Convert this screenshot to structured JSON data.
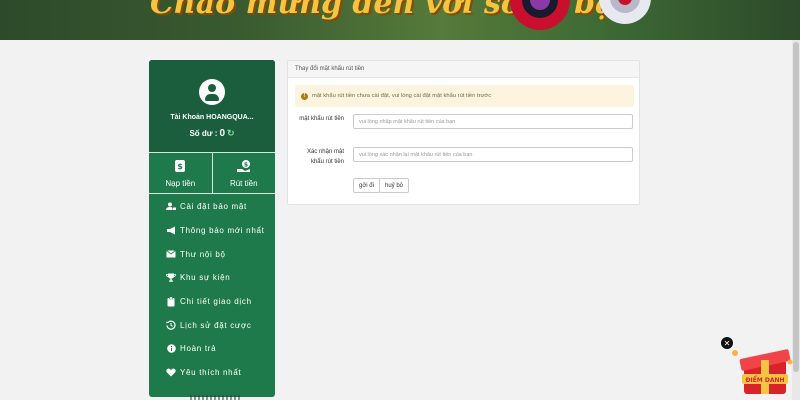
{
  "banner": {
    "text": "Chào mừng đến với sòng bạc"
  },
  "sidebar": {
    "account_name": "Tài Khoản HOANGQUA...",
    "balance_label": "Số dư :",
    "balance_value": "0",
    "deposit_label": "Nạp tiền",
    "withdraw_label": "Rút tiền",
    "menu": [
      {
        "label": "Cài đặt bảo mật",
        "icon": "user-lock-icon"
      },
      {
        "label": "Thông báo mới nhất",
        "icon": "megaphone-icon"
      },
      {
        "label": "Thư nội bộ",
        "icon": "envelope-icon"
      },
      {
        "label": "Khu sự kiện",
        "icon": "trophy-icon"
      },
      {
        "label": "Chi tiết giao dịch",
        "icon": "clipboard-icon"
      },
      {
        "label": "Lịch sử đặt cược",
        "icon": "history-icon"
      },
      {
        "label": "Hoàn trả",
        "icon": "info-circle-icon"
      },
      {
        "label": "Yêu thích nhất",
        "icon": "heart-icon"
      }
    ]
  },
  "panel": {
    "title": "Thay đổi mật khẩu rút tiền",
    "alert": "mật khẩu rút tiền chưa cài đặt, vui lòng cài đặt mật khẩu rút tiền trước",
    "field1_label": "mật khẩu rút tiền",
    "field1_placeholder": "vui lòng nhập mật khẩu rút tiền của bạn",
    "field1_value": "",
    "field2_label": "Xác nhận mật khẩu rút tiền",
    "field2_placeholder": "vui lòng xác nhận lại mật khẩu rút tiền của bạn",
    "field2_value": "",
    "submit_label": "gởi đi",
    "cancel_label": "huỷ bỏ"
  },
  "widget": {
    "close_label": "✕",
    "gift_label": "ĐIỂM DANH"
  },
  "colors": {
    "sidebar": "#1e7a4a",
    "account_bg": "#1a5e3e",
    "alert_bg": "#fcf4df"
  }
}
